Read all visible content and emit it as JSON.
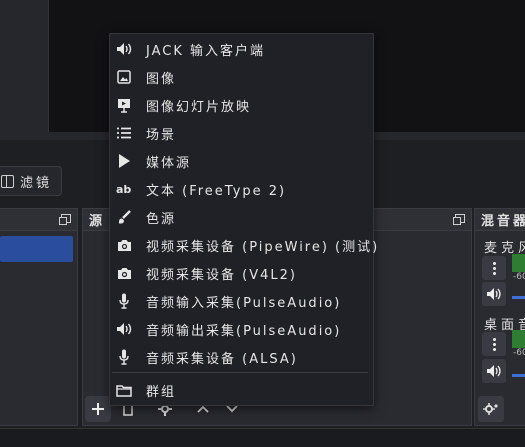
{
  "filters_button": {
    "label": "滤镜"
  },
  "docks": {
    "sources_title": "源",
    "mixer_title": "混音器"
  },
  "mixer": {
    "channels": [
      {
        "name": "麦克风",
        "meter_value": "-60"
      },
      {
        "name": "桌面音",
        "meter_value": "-60"
      }
    ]
  },
  "context_menu": {
    "items": [
      {
        "label": "JACK 输入客户端",
        "icon": "speaker-icon"
      },
      {
        "label": "图像",
        "icon": "image-icon"
      },
      {
        "label": "图像幻灯片放映",
        "icon": "slideshow-icon"
      },
      {
        "label": "场景",
        "icon": "list-icon"
      },
      {
        "label": "媒体源",
        "icon": "play-icon"
      },
      {
        "label": "文本 (FreeType 2)",
        "icon": "text-icon"
      },
      {
        "label": "色源",
        "icon": "brush-icon"
      },
      {
        "label": "视频采集设备 (PipeWire) (测试)",
        "icon": "camera-icon"
      },
      {
        "label": "视频采集设备 (V4L2)",
        "icon": "camera-icon"
      },
      {
        "label": "音频输入采集(PulseAudio)",
        "icon": "microphone-icon"
      },
      {
        "label": "音频输出采集(PulseAudio)",
        "icon": "speaker-icon"
      },
      {
        "label": "音频采集设备 (ALSA)",
        "icon": "microphone-icon"
      },
      {
        "label": "群组",
        "icon": "folder-icon"
      }
    ]
  },
  "colors": {
    "accent": "#2b4d9e",
    "menu_bg": "#202126",
    "panel_bg": "#2a2b30"
  }
}
